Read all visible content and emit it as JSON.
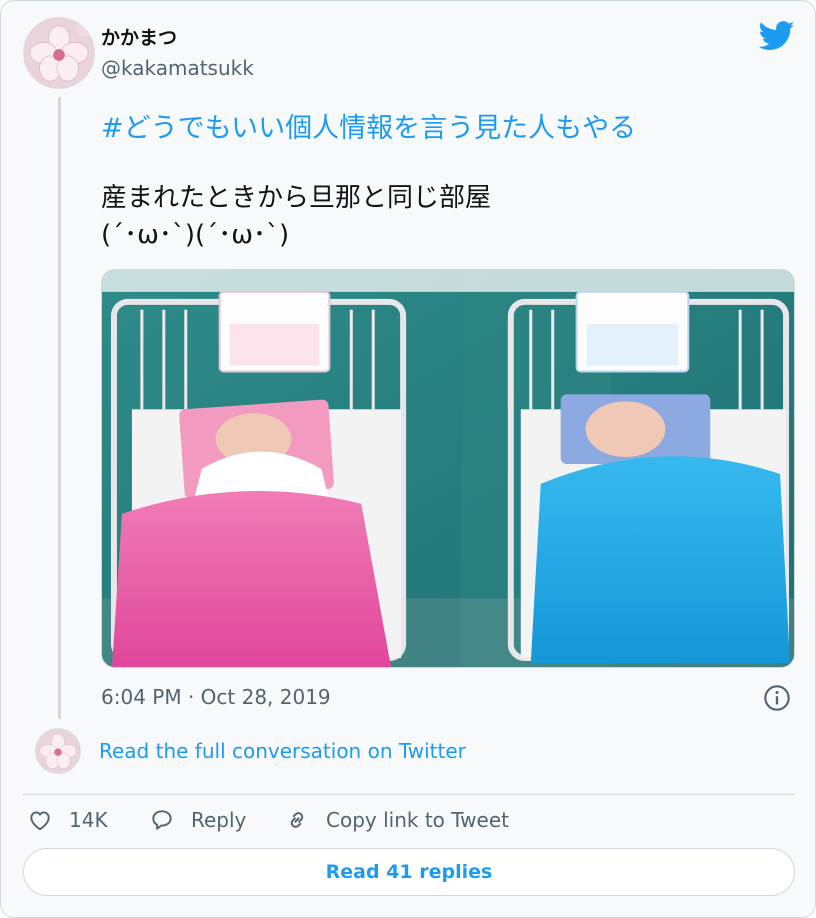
{
  "author": {
    "name": "かかまつ",
    "handle": "@kakamatsukk"
  },
  "tweet": {
    "hashtag": "#どうでもいい個人情報を言う見た人もやる",
    "body_lines": [
      "産まれたときから旦那と同じ部屋",
      "(´･ω･`)(´･ω･`)"
    ],
    "timestamp": "6:04 PM · Oct 28, 2019"
  },
  "conversation_link": "Read the full conversation on Twitter",
  "actions": {
    "like_count": "14K",
    "reply_label": "Reply",
    "copy_label": "Copy link to Tweet"
  },
  "read_replies_label": "Read 41 replies",
  "icons": {
    "brand": "twitter-bird-icon",
    "info": "info-icon",
    "like": "heart-icon",
    "reply": "speech-bubble-icon",
    "copy": "link-icon"
  },
  "colors": {
    "accent": "#1d9bf0",
    "secondary_text": "#536471",
    "card_background": "#f7f9fa",
    "border": "#cfd9de"
  }
}
